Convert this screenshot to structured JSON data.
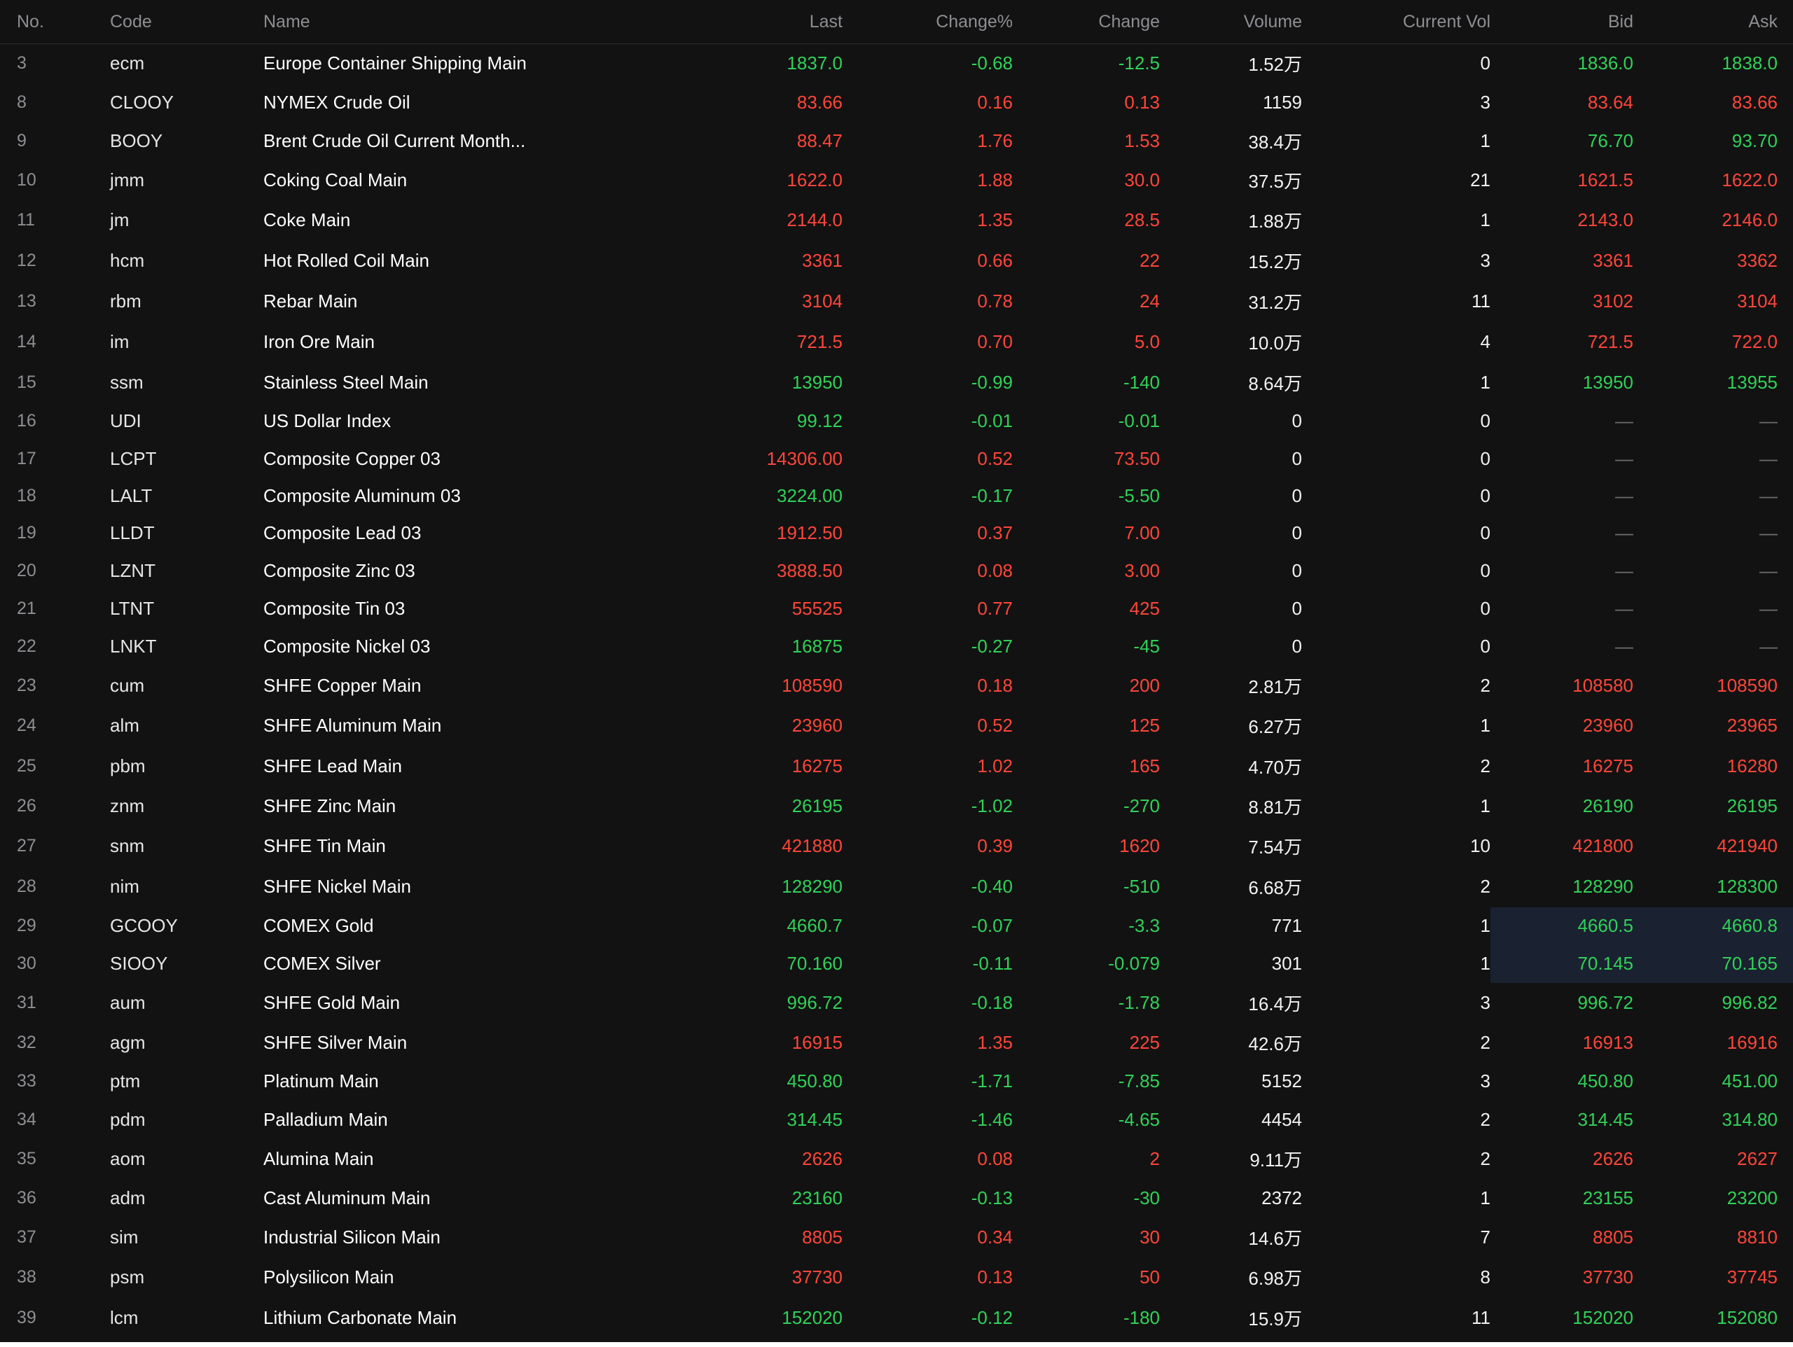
{
  "colors": {
    "background": "#121212",
    "up": "#ff453a",
    "down": "#30d158",
    "header_text": "#8e8e93",
    "highlight": "#1a2130"
  },
  "table": {
    "headers": {
      "no": "No.",
      "code": "Code",
      "name": "Name",
      "last": "Last",
      "change_pct": "Change%",
      "change": "Change",
      "volume": "Volume",
      "current_vol": "Current Vol",
      "bid": "Bid",
      "ask": "Ask"
    },
    "rows": [
      {
        "no": "3",
        "code": "ecm",
        "name": "Europe Container Shipping Main",
        "last": "1837.0",
        "change_pct": "-0.68",
        "change": "-12.5",
        "volume": "1.52万",
        "current_vol": "0",
        "bid": "1836.0",
        "ask": "1838.0",
        "trend": "neg",
        "bid_trend": "neg",
        "ask_trend": "neg",
        "height": 55,
        "highlight": false
      },
      {
        "no": "8",
        "code": "CLOOY",
        "name": "NYMEX Crude Oil",
        "last": "83.66",
        "change_pct": "0.16",
        "change": "0.13",
        "volume": "1159",
        "current_vol": "3",
        "bid": "83.64",
        "ask": "83.66",
        "trend": "pos",
        "bid_trend": "pos",
        "ask_trend": "pos",
        "height": 57,
        "highlight": false
      },
      {
        "no": "9",
        "code": "BOOY",
        "name": "Brent Crude Oil Current Month...",
        "last": "88.47",
        "change_pct": "1.76",
        "change": "1.53",
        "volume": "38.4万",
        "current_vol": "1",
        "bid": "76.70",
        "ask": "93.70",
        "trend": "pos",
        "bid_trend": "neg",
        "ask_trend": "neg",
        "height": 54,
        "highlight": false
      },
      {
        "no": "10",
        "code": "jmm",
        "name": "Coking Coal Main",
        "last": "1622.0",
        "change_pct": "1.88",
        "change": "30.0",
        "volume": "37.5万",
        "current_vol": "21",
        "bid": "1621.5",
        "ask": "1622.0",
        "trend": "pos",
        "bid_trend": "pos",
        "ask_trend": "pos",
        "height": 57,
        "highlight": false
      },
      {
        "no": "11",
        "code": "jm",
        "name": "Coke Main",
        "last": "2144.0",
        "change_pct": "1.35",
        "change": "28.5",
        "volume": "1.88万",
        "current_vol": "1",
        "bid": "2143.0",
        "ask": "2146.0",
        "trend": "pos",
        "bid_trend": "pos",
        "ask_trend": "pos",
        "height": 58,
        "highlight": false
      },
      {
        "no": "12",
        "code": "hcm",
        "name": "Hot Rolled Coil Main",
        "last": "3361",
        "change_pct": "0.66",
        "change": "22",
        "volume": "15.2万",
        "current_vol": "3",
        "bid": "3361",
        "ask": "3362",
        "trend": "pos",
        "bid_trend": "pos",
        "ask_trend": "pos",
        "height": 58,
        "highlight": false
      },
      {
        "no": "13",
        "code": "rbm",
        "name": "Rebar Main",
        "last": "3104",
        "change_pct": "0.78",
        "change": "24",
        "volume": "31.2万",
        "current_vol": "11",
        "bid": "3102",
        "ask": "3104",
        "trend": "pos",
        "bid_trend": "pos",
        "ask_trend": "pos",
        "height": 58,
        "highlight": false
      },
      {
        "no": "14",
        "code": "im",
        "name": "Iron Ore Main",
        "last": "721.5",
        "change_pct": "0.70",
        "change": "5.0",
        "volume": "10.0万",
        "current_vol": "4",
        "bid": "721.5",
        "ask": "722.0",
        "trend": "pos",
        "bid_trend": "pos",
        "ask_trend": "pos",
        "height": 58,
        "highlight": false
      },
      {
        "no": "15",
        "code": "ssm",
        "name": "Stainless Steel Main",
        "last": "13950",
        "change_pct": "-0.99",
        "change": "-140",
        "volume": "8.64万",
        "current_vol": "1",
        "bid": "13950",
        "ask": "13955",
        "trend": "neg",
        "bid_trend": "neg",
        "ask_trend": "neg",
        "height": 57,
        "highlight": false
      },
      {
        "no": "16",
        "code": "UDI",
        "name": "US Dollar Index",
        "last": "99.12",
        "change_pct": "-0.01",
        "change": "-0.01",
        "volume": "0",
        "current_vol": "0",
        "bid": "—",
        "ask": "—",
        "trend": "neg",
        "bid_trend": "dash",
        "ask_trend": "dash",
        "height": 54,
        "highlight": false
      },
      {
        "no": "17",
        "code": "LCPT",
        "name": "Composite Copper 03",
        "last": "14306.00",
        "change_pct": "0.52",
        "change": "73.50",
        "volume": "0",
        "current_vol": "0",
        "bid": "—",
        "ask": "—",
        "trend": "pos",
        "bid_trend": "dash",
        "ask_trend": "dash",
        "height": 53,
        "highlight": false
      },
      {
        "no": "18",
        "code": "LALT",
        "name": "Composite Aluminum 03",
        "last": "3224.00",
        "change_pct": "-0.17",
        "change": "-5.50",
        "volume": "0",
        "current_vol": "0",
        "bid": "—",
        "ask": "—",
        "trend": "neg",
        "bid_trend": "dash",
        "ask_trend": "dash",
        "height": 53,
        "highlight": false
      },
      {
        "no": "19",
        "code": "LLDT",
        "name": "Composite Lead 03",
        "last": "1912.50",
        "change_pct": "0.37",
        "change": "7.00",
        "volume": "0",
        "current_vol": "0",
        "bid": "—",
        "ask": "—",
        "trend": "pos",
        "bid_trend": "dash",
        "ask_trend": "dash",
        "height": 54,
        "highlight": false
      },
      {
        "no": "20",
        "code": "LZNT",
        "name": "Composite Zinc 03",
        "last": "3888.50",
        "change_pct": "0.08",
        "change": "3.00",
        "volume": "0",
        "current_vol": "0",
        "bid": "—",
        "ask": "—",
        "trend": "pos",
        "bid_trend": "dash",
        "ask_trend": "dash",
        "height": 54,
        "highlight": false
      },
      {
        "no": "21",
        "code": "LTNT",
        "name": "Composite Tin 03",
        "last": "55525",
        "change_pct": "0.77",
        "change": "425",
        "volume": "0",
        "current_vol": "0",
        "bid": "—",
        "ask": "—",
        "trend": "pos",
        "bid_trend": "dash",
        "ask_trend": "dash",
        "height": 54,
        "highlight": false
      },
      {
        "no": "22",
        "code": "LNKT",
        "name": "Composite Nickel 03",
        "last": "16875",
        "change_pct": "-0.27",
        "change": "-45",
        "volume": "0",
        "current_vol": "0",
        "bid": "—",
        "ask": "—",
        "trend": "neg",
        "bid_trend": "dash",
        "ask_trend": "dash",
        "height": 54,
        "highlight": false
      },
      {
        "no": "23",
        "code": "cum",
        "name": "SHFE Copper Main",
        "last": "108590",
        "change_pct": "0.18",
        "change": "200",
        "volume": "2.81万",
        "current_vol": "2",
        "bid": "108580",
        "ask": "108590",
        "trend": "pos",
        "bid_trend": "pos",
        "ask_trend": "pos",
        "height": 57,
        "highlight": false
      },
      {
        "no": "24",
        "code": "alm",
        "name": "SHFE Aluminum Main",
        "last": "23960",
        "change_pct": "0.52",
        "change": "125",
        "volume": "6.27万",
        "current_vol": "1",
        "bid": "23960",
        "ask": "23965",
        "trend": "pos",
        "bid_trend": "pos",
        "ask_trend": "pos",
        "height": 58,
        "highlight": false
      },
      {
        "no": "25",
        "code": "pbm",
        "name": "SHFE Lead Main",
        "last": "16275",
        "change_pct": "1.02",
        "change": "165",
        "volume": "4.70万",
        "current_vol": "2",
        "bid": "16275",
        "ask": "16280",
        "trend": "pos",
        "bid_trend": "pos",
        "ask_trend": "pos",
        "height": 57,
        "highlight": false
      },
      {
        "no": "26",
        "code": "znm",
        "name": "SHFE Zinc Main",
        "last": "26195",
        "change_pct": "-1.02",
        "change": "-270",
        "volume": "8.81万",
        "current_vol": "1",
        "bid": "26190",
        "ask": "26195",
        "trend": "neg",
        "bid_trend": "neg",
        "ask_trend": "neg",
        "height": 57,
        "highlight": false
      },
      {
        "no": "27",
        "code": "snm",
        "name": "SHFE Tin Main",
        "last": "421880",
        "change_pct": "0.39",
        "change": "1620",
        "volume": "7.54万",
        "current_vol": "10",
        "bid": "421800",
        "ask": "421940",
        "trend": "pos",
        "bid_trend": "pos",
        "ask_trend": "pos",
        "height": 58,
        "highlight": false
      },
      {
        "no": "28",
        "code": "nim",
        "name": "SHFE Nickel Main",
        "last": "128290",
        "change_pct": "-0.40",
        "change": "-510",
        "volume": "6.68万",
        "current_vol": "2",
        "bid": "128290",
        "ask": "128300",
        "trend": "neg",
        "bid_trend": "neg",
        "ask_trend": "neg",
        "height": 58,
        "highlight": false
      },
      {
        "no": "29",
        "code": "GCOOY",
        "name": "COMEX Gold",
        "last": "4660.7",
        "change_pct": "-0.07",
        "change": "-3.3",
        "volume": "771",
        "current_vol": "1",
        "bid": "4660.5",
        "ask": "4660.8",
        "trend": "neg",
        "bid_trend": "neg",
        "ask_trend": "neg",
        "height": 54,
        "highlight": true
      },
      {
        "no": "30",
        "code": "SIOOY",
        "name": "COMEX Silver",
        "last": "70.160",
        "change_pct": "-0.11",
        "change": "-0.079",
        "volume": "301",
        "current_vol": "1",
        "bid": "70.145",
        "ask": "70.165",
        "trend": "neg",
        "bid_trend": "neg",
        "ask_trend": "neg",
        "height": 54,
        "highlight": true
      },
      {
        "no": "31",
        "code": "aum",
        "name": "SHFE Gold Main",
        "last": "996.72",
        "change_pct": "-0.18",
        "change": "-1.78",
        "volume": "16.4万",
        "current_vol": "3",
        "bid": "996.72",
        "ask": "996.82",
        "trend": "neg",
        "bid_trend": "neg",
        "ask_trend": "neg",
        "height": 57,
        "highlight": false
      },
      {
        "no": "32",
        "code": "agm",
        "name": "SHFE Silver Main",
        "last": "16915",
        "change_pct": "1.35",
        "change": "225",
        "volume": "42.6万",
        "current_vol": "2",
        "bid": "16913",
        "ask": "16916",
        "trend": "pos",
        "bid_trend": "pos",
        "ask_trend": "pos",
        "height": 57,
        "highlight": false
      },
      {
        "no": "33",
        "code": "ptm",
        "name": "Platinum Main",
        "last": "450.80",
        "change_pct": "-1.71",
        "change": "-7.85",
        "volume": "5152",
        "current_vol": "3",
        "bid": "450.80",
        "ask": "451.00",
        "trend": "neg",
        "bid_trend": "neg",
        "ask_trend": "neg",
        "height": 54,
        "highlight": false
      },
      {
        "no": "34",
        "code": "pdm",
        "name": "Palladium Main",
        "last": "314.45",
        "change_pct": "-1.46",
        "change": "-4.65",
        "volume": "4454",
        "current_vol": "2",
        "bid": "314.45",
        "ask": "314.80",
        "trend": "neg",
        "bid_trend": "neg",
        "ask_trend": "neg",
        "height": 55,
        "highlight": false
      },
      {
        "no": "35",
        "code": "aom",
        "name": "Alumina Main",
        "last": "2626",
        "change_pct": "0.08",
        "change": "2",
        "volume": "9.11万",
        "current_vol": "2",
        "bid": "2626",
        "ask": "2627",
        "trend": "pos",
        "bid_trend": "pos",
        "ask_trend": "pos",
        "height": 57,
        "highlight": false
      },
      {
        "no": "36",
        "code": "adm",
        "name": "Cast Aluminum Main",
        "last": "23160",
        "change_pct": "-0.13",
        "change": "-30",
        "volume": "2372",
        "current_vol": "1",
        "bid": "23155",
        "ask": "23200",
        "trend": "neg",
        "bid_trend": "neg",
        "ask_trend": "neg",
        "height": 55,
        "highlight": false
      },
      {
        "no": "37",
        "code": "sim",
        "name": "Industrial Silicon Main",
        "last": "8805",
        "change_pct": "0.34",
        "change": "30",
        "volume": "14.6万",
        "current_vol": "7",
        "bid": "8805",
        "ask": "8810",
        "trend": "pos",
        "bid_trend": "pos",
        "ask_trend": "pos",
        "height": 57,
        "highlight": false
      },
      {
        "no": "38",
        "code": "psm",
        "name": "Polysilicon Main",
        "last": "37730",
        "change_pct": "0.13",
        "change": "50",
        "volume": "6.98万",
        "current_vol": "8",
        "bid": "37730",
        "ask": "37745",
        "trend": "pos",
        "bid_trend": "pos",
        "ask_trend": "pos",
        "height": 58,
        "highlight": false
      },
      {
        "no": "39",
        "code": "lcm",
        "name": "Lithium Carbonate Main",
        "last": "152020",
        "change_pct": "-0.12",
        "change": "-180",
        "volume": "15.9万",
        "current_vol": "11",
        "bid": "152020",
        "ask": "152080",
        "trend": "neg",
        "bid_trend": "neg",
        "ask_trend": "neg",
        "height": 57,
        "highlight": false
      }
    ]
  }
}
